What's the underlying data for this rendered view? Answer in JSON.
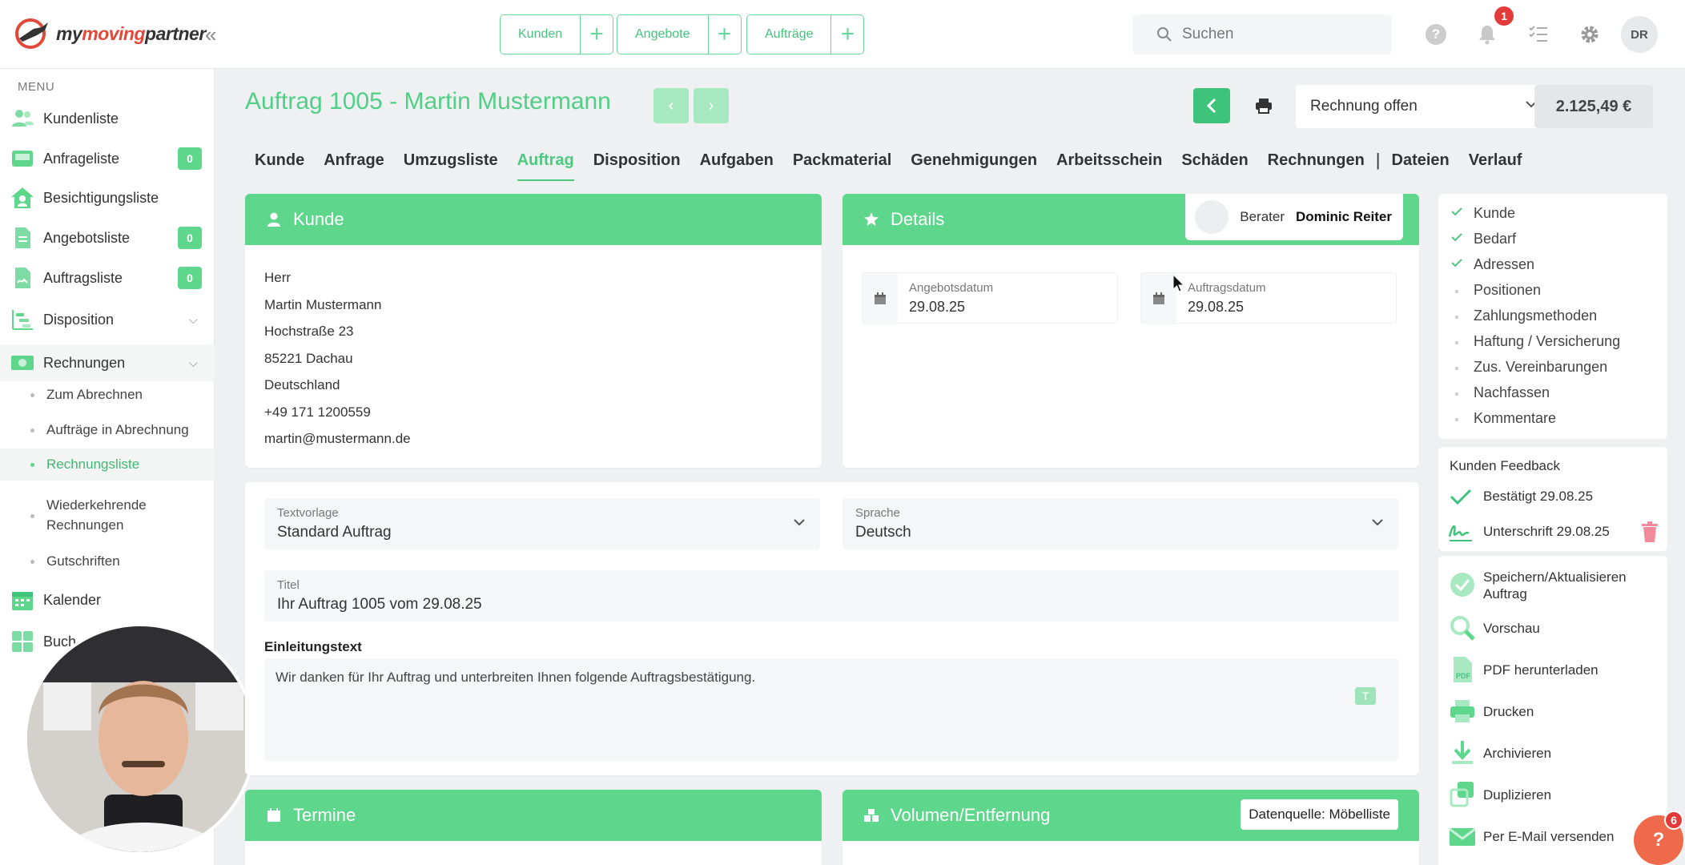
{
  "brand": {
    "name_part1": "my",
    "name_part2": "moving",
    "name_part3": "partner"
  },
  "quick_actions": [
    {
      "label": "Kunden"
    },
    {
      "label": "Angebote"
    },
    {
      "label": "Aufträge"
    }
  ],
  "search": {
    "placeholder": "Suchen"
  },
  "header_icons": {
    "help": "?",
    "notifications_count": "1",
    "user_initials": "DR"
  },
  "sidebar": {
    "menu_title": "MENU",
    "items": [
      {
        "label": "Kundenliste"
      },
      {
        "label": "Anfrageliste",
        "count": "0"
      },
      {
        "label": "Besichtigungsliste"
      },
      {
        "label": "Angebotsliste",
        "count": "0"
      },
      {
        "label": "Auftragsliste",
        "count": "0"
      },
      {
        "label": "Disposition"
      },
      {
        "label": "Rechnungen"
      },
      {
        "label": "Kalender"
      },
      {
        "label": "Buch"
      }
    ],
    "rechnungen_sub": [
      {
        "label": "Zum Abrechnen"
      },
      {
        "label": "Aufträge in Abrechnung"
      },
      {
        "label": "Rechnungsliste"
      },
      {
        "label": "Wiederkehrende Rechnungen"
      },
      {
        "label": "Gutschriften"
      }
    ]
  },
  "page": {
    "title": "Auftrag 1005 - Martin Mustermann",
    "status": "Rechnung offen",
    "amount": "2.125,49 €"
  },
  "tabs": [
    "Kunde",
    "Anfrage",
    "Umzugsliste",
    "Auftrag",
    "Disposition",
    "Aufgaben",
    "Packmaterial",
    "Genehmigungen",
    "Arbeitsschein",
    "Schäden",
    "Rechnungen",
    "Dateien",
    "Verlauf"
  ],
  "tab_separator": "|",
  "kunde_card": {
    "title": "Kunde",
    "lines": [
      "Herr",
      "Martin Mustermann",
      "Hochstraße 23",
      "85221 Dachau",
      "Deutschland",
      "+49 171 1200559",
      "martin@mustermann.de"
    ]
  },
  "details_card": {
    "title": "Details",
    "berater_label": "Berater",
    "berater_name": "Dominic Reiter",
    "angebotsdatum_label": "Angebotsdatum",
    "angebotsdatum": "29.08.25",
    "auftragsdatum_label": "Auftragsdatum",
    "auftragsdatum": "29.08.25"
  },
  "form": {
    "textvorlage_label": "Textvorlage",
    "textvorlage": "Standard Auftrag",
    "sprache_label": "Sprache",
    "sprache": "Deutsch",
    "titel_label": "Titel",
    "titel": "Ihr Auftrag 1005 vom 29.08.25",
    "einleitung_label": "Einleitungstext",
    "einleitung": "Wir danken für Ihr Auftrag und unterbreiten Ihnen folgende Auftragsbestätigung.",
    "text_icon": "T"
  },
  "termine_card": {
    "title": "Termine"
  },
  "volumen_card": {
    "title": "Volumen/Entfernung",
    "datenquelle": "Datenquelle: Möbelliste"
  },
  "checklist": [
    {
      "label": "Kunde",
      "done": true
    },
    {
      "label": "Bedarf",
      "done": true
    },
    {
      "label": "Adressen",
      "done": true
    },
    {
      "label": "Positionen",
      "done": false
    },
    {
      "label": "Zahlungsmethoden",
      "done": false
    },
    {
      "label": "Haftung / Versicherung",
      "done": false
    },
    {
      "label": "Zus. Vereinbarungen",
      "done": false
    },
    {
      "label": "Nachfassen",
      "done": false
    },
    {
      "label": "Kommentare",
      "done": false
    }
  ],
  "feedback": {
    "title": "Kunden Feedback",
    "confirmed": "Bestätigt 29.08.25",
    "signature": "Unterschrift 29.08.25"
  },
  "actions": [
    {
      "label": "Speichern/Aktualisieren Auftrag",
      "icon": "check-circle-icon"
    },
    {
      "label": "Vorschau",
      "icon": "magnifier-icon"
    },
    {
      "label": "PDF herunterladen",
      "icon": "pdf-icon"
    },
    {
      "label": "Drucken",
      "icon": "printer-icon"
    },
    {
      "label": "Archivieren",
      "icon": "download-icon"
    },
    {
      "label": "Duplizieren",
      "icon": "duplicate-icon"
    },
    {
      "label": "Per E-Mail versenden",
      "icon": "mail-icon"
    }
  ],
  "help_fab": {
    "label": "?",
    "badge": "6"
  },
  "colors": {
    "accent": "#5ed68c",
    "accent_dark": "#3ec47a",
    "brand_red": "#e0483a",
    "badge_red": "#e33a3a"
  }
}
